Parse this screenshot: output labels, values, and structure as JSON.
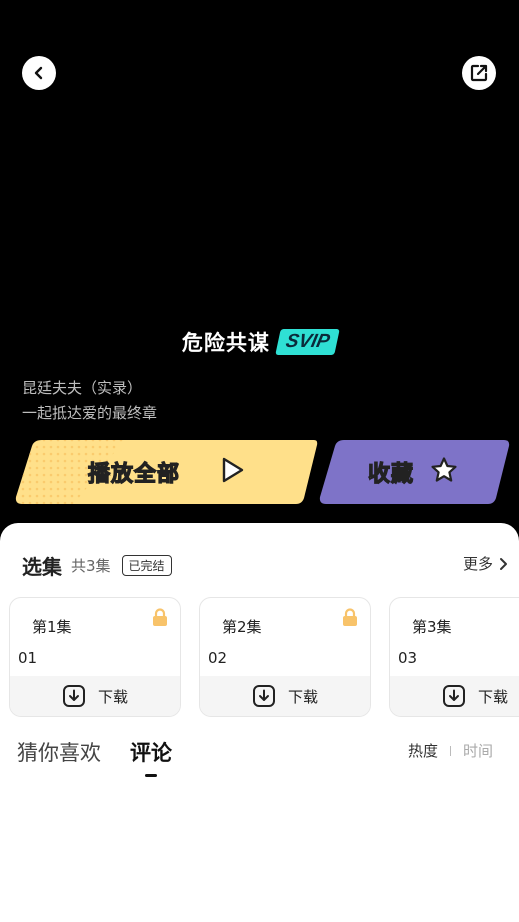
{
  "header": {
    "back_icon": "chevron-left-icon",
    "share_icon": "share-external-icon"
  },
  "show": {
    "title": "危险共谋",
    "badge": "SVIP",
    "subtitle_line1": "昆廷夫夫（实录）",
    "subtitle_line2": "一起抵达爱的最终章"
  },
  "actions": {
    "play_all_label": "播放全部",
    "favorite_label": "收藏",
    "play_color": "#FFE08A",
    "favorite_color": "#7E73C8"
  },
  "episodes": {
    "title": "选集",
    "count": "共3集",
    "status_badge": "已完结",
    "more_label": "更多",
    "items": [
      {
        "name": "第1集",
        "number": "01",
        "download_label": "下载",
        "locked": true
      },
      {
        "name": "第2集",
        "number": "02",
        "download_label": "下载",
        "locked": true
      },
      {
        "name": "第3集",
        "number": "03",
        "download_label": "下载",
        "locked": false
      }
    ],
    "lock_color": "#F8C36A"
  },
  "tabs": {
    "items": [
      "猜你喜欢",
      "评论"
    ],
    "active": "评论"
  },
  "sort": {
    "hot_label": "热度",
    "time_label": "时间"
  }
}
